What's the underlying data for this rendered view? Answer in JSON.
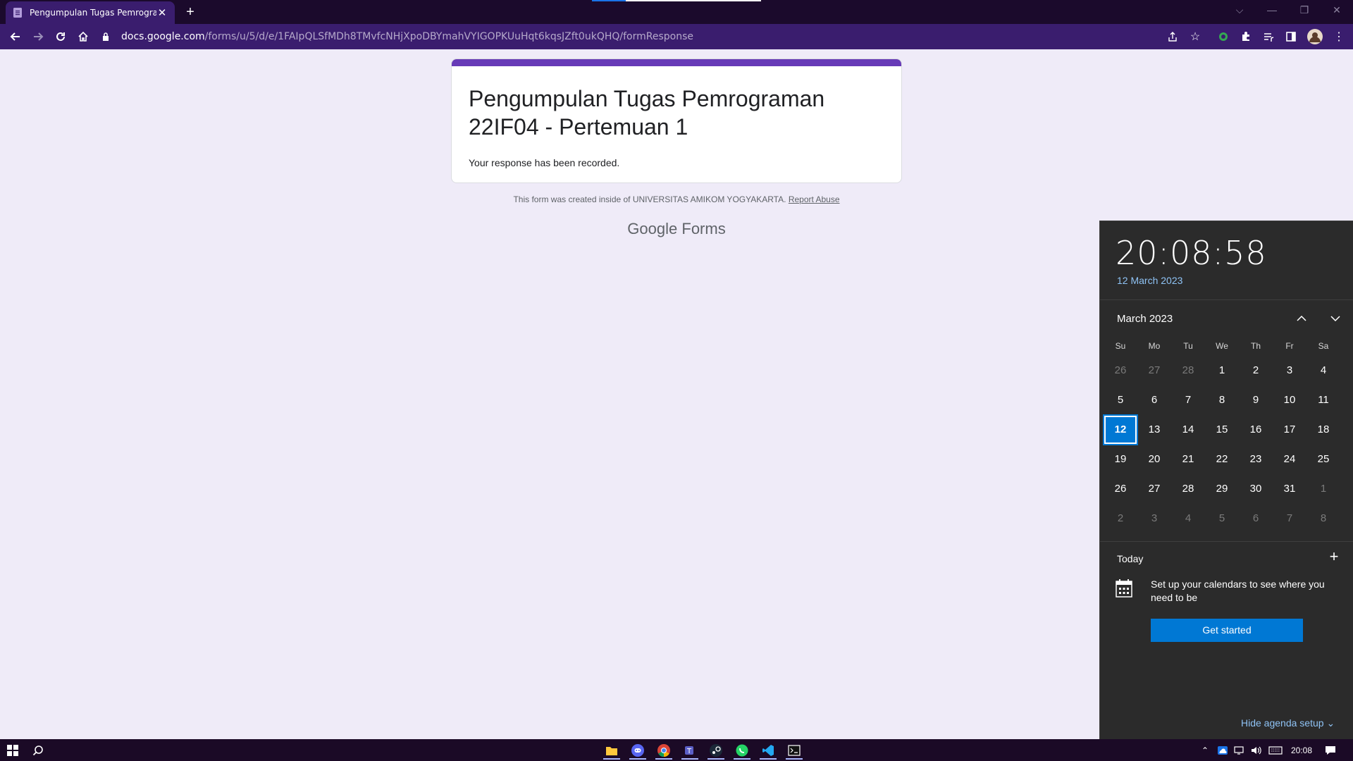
{
  "browser": {
    "tab_title": "Pengumpulan Tugas Pemrogram",
    "url_host": "docs.google.com",
    "url_path": "/forms/u/5/d/e/1FAIpQLSfMDh8TMvfcNHjXpoDBYmahVYIGOPKUuHqt6kqsJZft0ukQHQ/formResponse"
  },
  "form": {
    "title": "Pengumpulan Tugas Pemrograman 22IF04 - Pertemuan 1",
    "confirmation": "Your response has been recorded.",
    "footer_note": "This form was created inside of UNIVERSITAS AMIKOM YOGYAKARTA.",
    "report_abuse": "Report Abuse",
    "logo_google": "Google",
    "logo_forms": "Forms"
  },
  "calendar": {
    "time": "20:08:58",
    "date": "12 March 2023",
    "month": "March 2023",
    "weekdays": [
      "Su",
      "Mo",
      "Tu",
      "We",
      "Th",
      "Fr",
      "Sa"
    ],
    "weeks": [
      [
        "26",
        "27",
        "28",
        "1",
        "2",
        "3",
        "4"
      ],
      [
        "5",
        "6",
        "7",
        "8",
        "9",
        "10",
        "11"
      ],
      [
        "12",
        "13",
        "14",
        "15",
        "16",
        "17",
        "18"
      ],
      [
        "19",
        "20",
        "21",
        "22",
        "23",
        "24",
        "25"
      ],
      [
        "26",
        "27",
        "28",
        "29",
        "30",
        "31",
        "1"
      ],
      [
        "2",
        "3",
        "4",
        "5",
        "6",
        "7",
        "8"
      ]
    ],
    "today_label": "Today",
    "agenda_text": "Set up your calendars to see where you need to be",
    "get_started": "Get started",
    "hide_agenda": "Hide agenda setup"
  },
  "taskbar": {
    "clock": "20:08"
  },
  "colors": {
    "form_accent": "#673ab7",
    "calendar_today": "#0078d4",
    "link_blue": "#8fc3f5"
  }
}
